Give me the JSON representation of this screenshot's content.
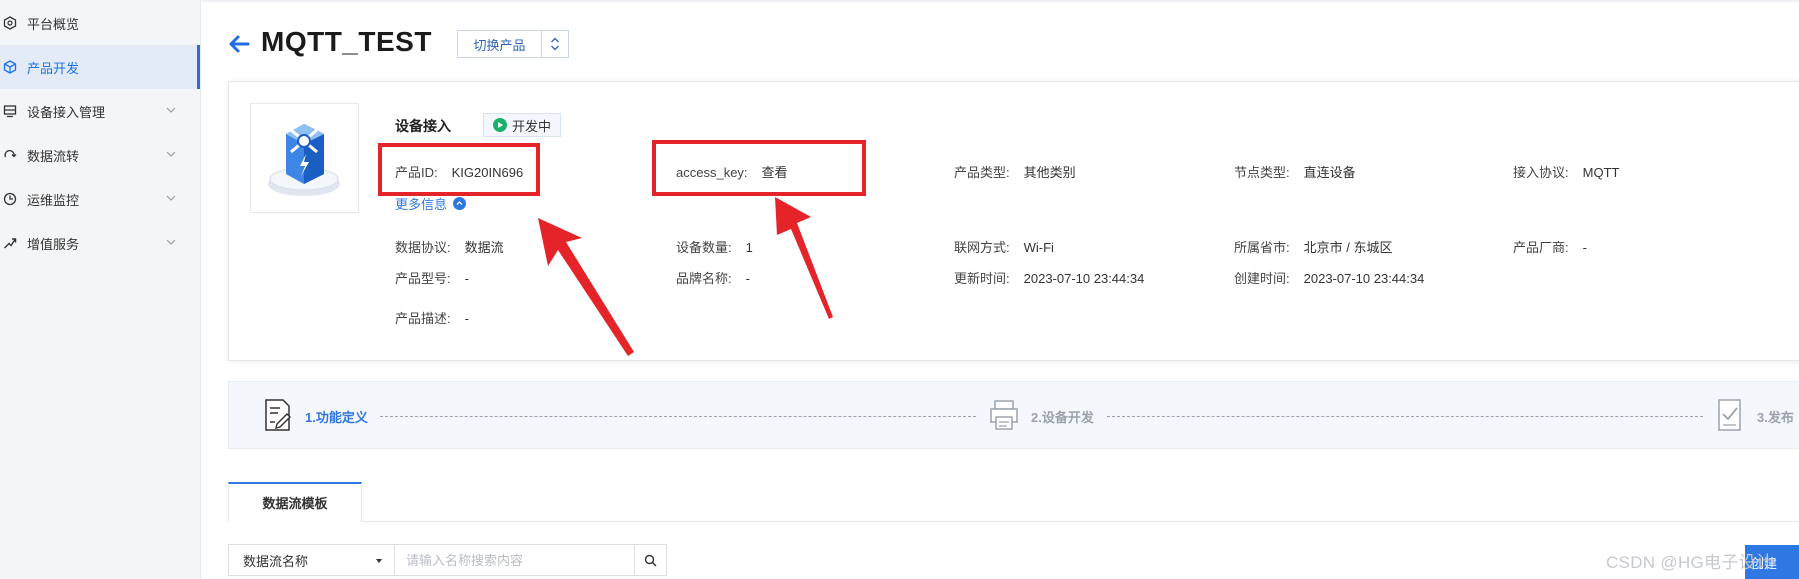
{
  "sidebar": {
    "items": [
      {
        "label": "平台概览",
        "icon": "dashboard-icon",
        "has_chevron": false,
        "active": false
      },
      {
        "label": "产品开发",
        "icon": "cube-icon",
        "has_chevron": false,
        "active": true
      },
      {
        "label": "设备接入管理",
        "icon": "device-icon",
        "has_chevron": true,
        "active": false
      },
      {
        "label": "数据流转",
        "icon": "data-flow-icon",
        "has_chevron": true,
        "active": false
      },
      {
        "label": "运维监控",
        "icon": "monitor-icon",
        "has_chevron": true,
        "active": false
      },
      {
        "label": "增值服务",
        "icon": "service-icon",
        "has_chevron": true,
        "active": false
      }
    ]
  },
  "header": {
    "title": "MQTT_TEST",
    "switch_label": "切换产品"
  },
  "product": {
    "section_title": "设备接入",
    "status": "开发中",
    "id_label": "产品ID:",
    "id_value": "KIG20IN696",
    "access_key_label": "access_key:",
    "access_key_link": "查看",
    "type_label": "产品类型:",
    "type_value": "其他类别",
    "node_label": "节点类型:",
    "node_value": "直连设备",
    "protocol_label": "接入协议:",
    "protocol_value": "MQTT",
    "more_info": "更多信息",
    "data_protocol_label": "数据协议:",
    "data_protocol_value": "数据流",
    "device_count_label": "设备数量:",
    "device_count_value": "1",
    "network_label": "联网方式:",
    "network_value": "Wi-Fi",
    "region_label": "所属省市:",
    "region_value": "北京市 / 东城区",
    "vendor_label": "产品厂商:",
    "vendor_value": "-",
    "model_label": "产品型号:",
    "model_value": "-",
    "brand_label": "品牌名称:",
    "brand_value": "-",
    "updated_label": "更新时间:",
    "updated_value": "2023-07-10 23:44:34",
    "created_label": "创建时间:",
    "created_value": "2023-07-10 23:44:34",
    "desc_label": "产品描述:",
    "desc_value": "-"
  },
  "steps": [
    {
      "label": "1.功能定义",
      "icon": "document-edit-icon",
      "active": true
    },
    {
      "label": "2.设备开发",
      "icon": "printer-icon",
      "active": false
    },
    {
      "label": "3.发布",
      "icon": "checklist-icon",
      "active": false
    }
  ],
  "tabs": [
    {
      "label": "数据流模板"
    }
  ],
  "filter": {
    "select_value": "数据流名称",
    "search_placeholder": "请输入名称搜索内容",
    "create_label": "创建"
  },
  "watermark": "CSDN @HG电子设计",
  "colors": {
    "accent": "#2f78e4",
    "active_bg": "#e3ebf8",
    "status_green": "#19b36b",
    "annotation_red": "#e5242a"
  }
}
